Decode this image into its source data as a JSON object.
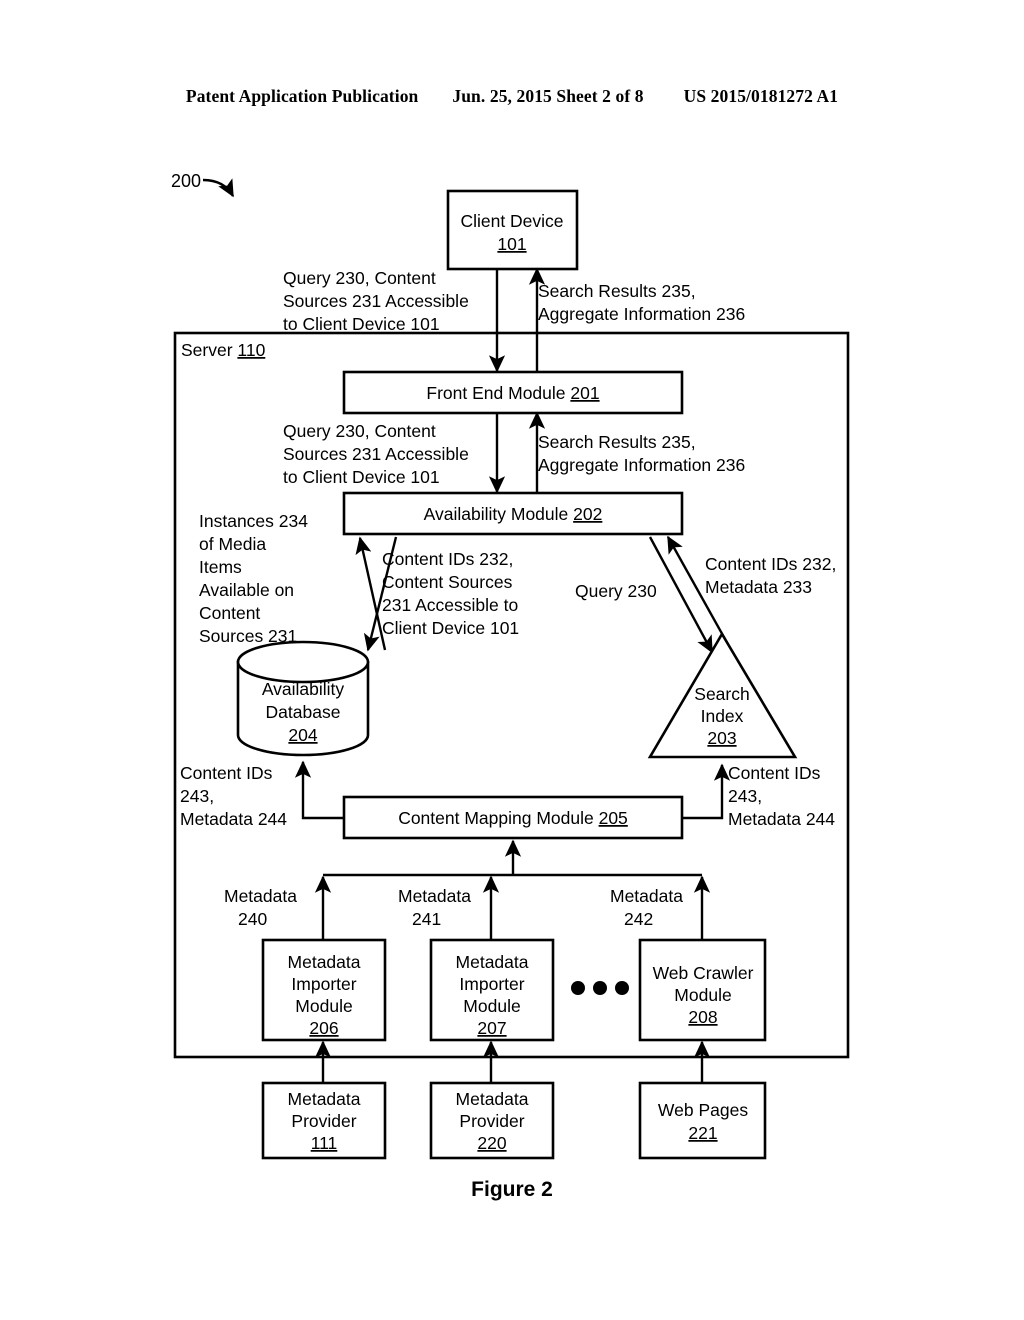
{
  "header": {
    "left": "Patent Application Publication",
    "middle": "Jun. 25, 2015  Sheet 2 of 8",
    "right": "US 2015/0181272 A1"
  },
  "figure": {
    "caption": "Figure 2",
    "system_ref": "200"
  },
  "container": {
    "server_label": "Server ",
    "server_ref": "110"
  },
  "nodes": {
    "client_device": {
      "line1": "Client Device",
      "ref": "101"
    },
    "front_end_module": {
      "line1": "Front End Module ",
      "ref": "201"
    },
    "availability_module": {
      "line1": "Availability Module ",
      "ref": "202"
    },
    "availability_database": {
      "line1": "Availability",
      "line2": "Database",
      "ref": "204"
    },
    "search_index": {
      "line1": "Search",
      "line2": "Index",
      "ref": "203"
    },
    "content_mapping_module": {
      "line1": "Content Mapping Module ",
      "ref": "205"
    },
    "metadata_importer_206": {
      "line1": "Metadata",
      "line2": "Importer",
      "line3": "Module",
      "ref": "206"
    },
    "metadata_importer_207": {
      "line1": "Metadata",
      "line2": "Importer",
      "line3": "Module",
      "ref": "207"
    },
    "web_crawler_208": {
      "line1": "Web Crawler",
      "line2": "Module",
      "ref": "208"
    },
    "metadata_provider_111": {
      "line1": "Metadata",
      "line2": "Provider",
      "ref": "111"
    },
    "metadata_provider_220": {
      "line1": "Metadata",
      "line2": "Provider",
      "ref": "220"
    },
    "web_pages_221": {
      "line1": "Web Pages",
      "ref": "221"
    },
    "ellipsis": "• • •"
  },
  "edge_labels": {
    "client_to_server_query": {
      "line1": "Query 230, Content",
      "line2": "Sources 231 Accessible",
      "line3": "to Client Device 101"
    },
    "server_to_client_results": {
      "line1": "Search Results 235,",
      "line2": "Aggregate Information 236"
    },
    "frontend_to_availability_query": {
      "line1": "Query 230, Content",
      "line2": "Sources 231 Accessible",
      "line3": "to Client Device 101"
    },
    "availability_to_frontend_results": {
      "line1": "Search Results 235,",
      "line2": "Aggregate Information 236"
    },
    "instances_available": {
      "line1": "Instances 234",
      "line2": "of Media",
      "line3": "Items",
      "line4": "Available on",
      "line5": "Content",
      "line6": "Sources 231"
    },
    "content_ids_sources": {
      "line1": "Content IDs 232,",
      "line2": "Content Sources",
      "line3": "231 Accessible to",
      "line4": "Client Device 101"
    },
    "query_230": {
      "line1": "Query 230"
    },
    "content_ids_metadata_233": {
      "line1": "Content IDs 232,",
      "line2": "Metadata 233"
    },
    "content_ids_244_left": {
      "line1": "Content IDs",
      "line2": "243,",
      "line3": "Metadata 244"
    },
    "content_ids_244_right": {
      "line1": "Content IDs",
      "line2": "243,",
      "line3": "Metadata 244"
    },
    "metadata_240": {
      "line1": "Metadata",
      "line2": "240"
    },
    "metadata_241": {
      "line1": "Metadata",
      "line2": "241"
    },
    "metadata_242": {
      "line1": "Metadata",
      "line2": "242"
    }
  }
}
